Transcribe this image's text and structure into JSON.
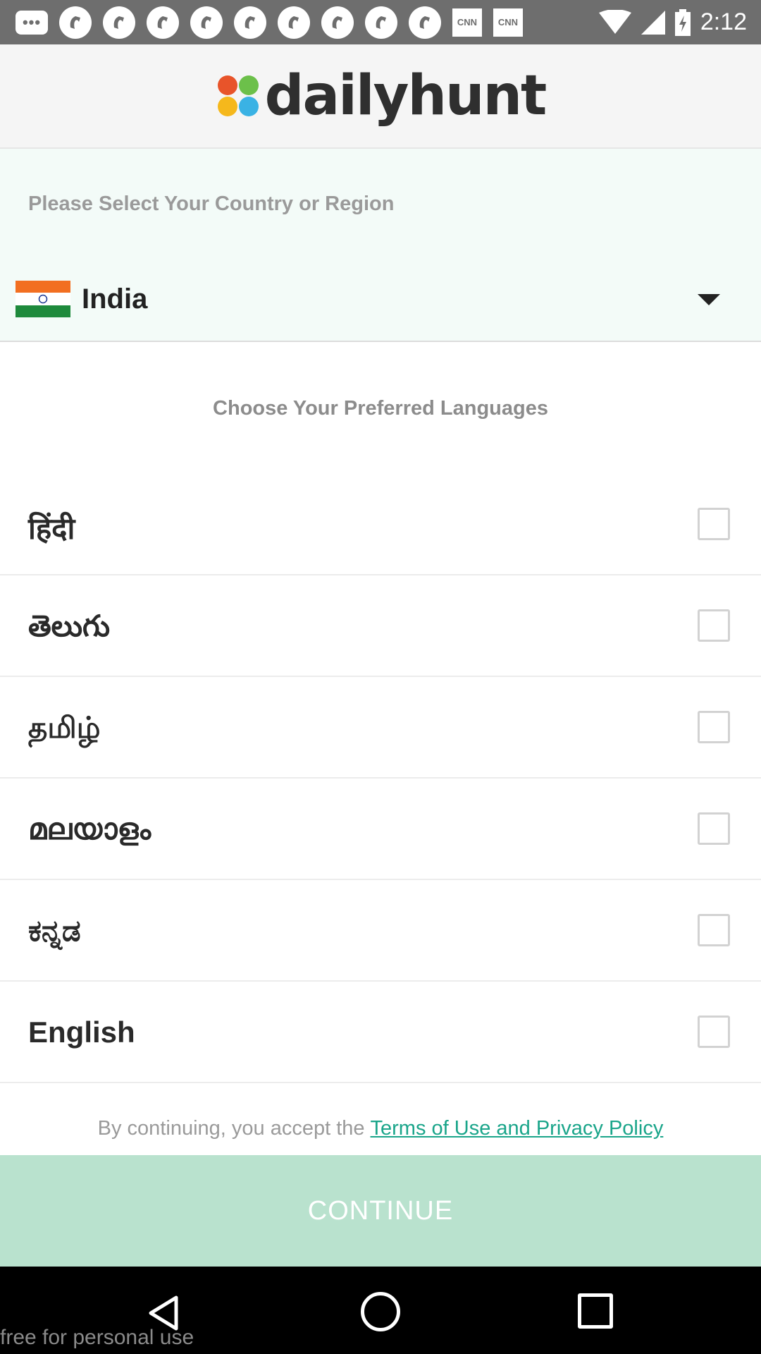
{
  "status_bar": {
    "time": "2:12",
    "notifications": [
      "message-icon",
      "app-icon",
      "app-icon",
      "app-icon",
      "app-icon",
      "app-icon",
      "app-icon",
      "app-icon",
      "app-icon",
      "app-icon",
      "cnn-icon",
      "cnn-icon"
    ],
    "cnn_label": "CNN"
  },
  "header": {
    "logo_text": "dailyhunt"
  },
  "country": {
    "prompt": "Please Select Your Country or Region",
    "selected": "India"
  },
  "languages": {
    "title": "Choose Your Preferred Languages",
    "items": [
      {
        "label": "हिंदी",
        "checked": false
      },
      {
        "label": "తెలుగు",
        "checked": false
      },
      {
        "label": "தமிழ்",
        "checked": false
      },
      {
        "label": "മലയാളം",
        "checked": false
      },
      {
        "label": "ಕನ್ನಡ",
        "checked": false
      },
      {
        "label": "English",
        "checked": false
      }
    ]
  },
  "terms": {
    "text": "By continuing, you accept the",
    "link": "Terms of Use and Privacy Policy"
  },
  "continue_label": "CONTINUE",
  "watermark": "free for personal use",
  "colors": {
    "accent": "#1aa58a",
    "continue_bg": "#b9e2ce",
    "country_bg": "#f3fbf8"
  }
}
